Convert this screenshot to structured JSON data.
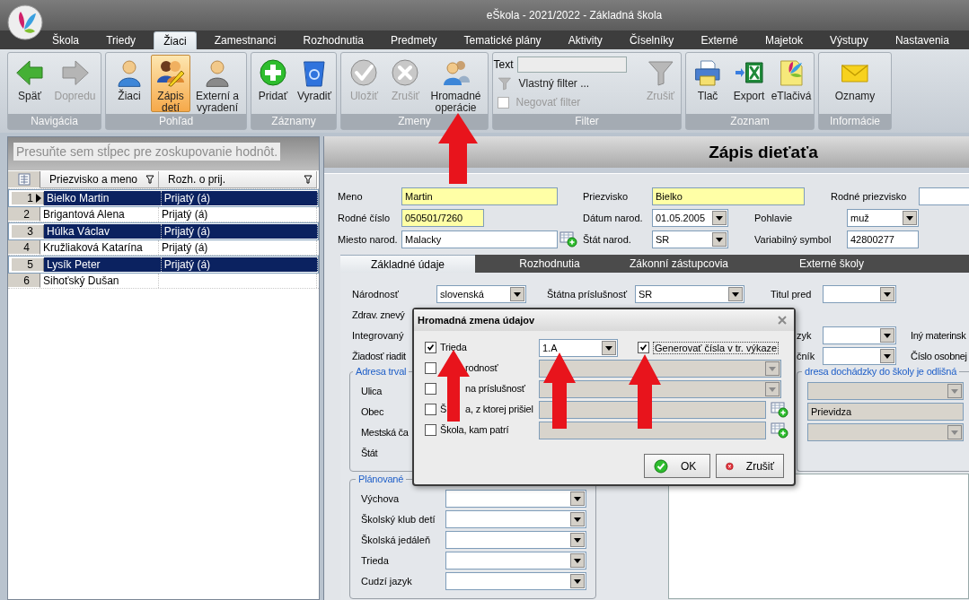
{
  "window": {
    "title": "eŠkola - 2021/2022 - Základná škola"
  },
  "menu_tabs": [
    {
      "label": "Škola",
      "selected": false
    },
    {
      "label": "Triedy",
      "selected": false
    },
    {
      "label": "Žiaci",
      "selected": true
    },
    {
      "label": "Zamestnanci",
      "selected": false
    },
    {
      "label": "Rozhodnutia",
      "selected": false
    },
    {
      "label": "Predmety",
      "selected": false
    },
    {
      "label": "Tematické plány",
      "selected": false
    },
    {
      "label": "Aktivity",
      "selected": false
    },
    {
      "label": "Číselníky",
      "selected": false
    },
    {
      "label": "Externé",
      "selected": false
    },
    {
      "label": "Majetok",
      "selected": false
    },
    {
      "label": "Výstupy",
      "selected": false
    },
    {
      "label": "Nastavenia",
      "selected": false
    }
  ],
  "ribbon_groups": [
    {
      "label": "Navigácia",
      "kind": "buttons",
      "buttons": [
        {
          "label": "Späť",
          "kind": "back",
          "disabled": false,
          "selected": false
        },
        {
          "label": "Dopredu",
          "kind": "forward",
          "disabled": true,
          "selected": false
        }
      ]
    },
    {
      "label": "Pohľad",
      "kind": "buttons",
      "buttons": [
        {
          "label": "Žiaci",
          "kind": "person",
          "disabled": false,
          "selected": false
        },
        {
          "label": "Zápis\ndetí",
          "kind": "enroll",
          "disabled": false,
          "selected": true
        },
        {
          "label": "Externí a\nvyradení",
          "kind": "person_gray",
          "disabled": false,
          "selected": false
        }
      ]
    },
    {
      "label": "Záznamy",
      "kind": "buttons",
      "buttons": [
        {
          "label": "Pridať",
          "kind": "add",
          "disabled": false,
          "selected": false
        },
        {
          "label": "Vyradiť",
          "kind": "delete",
          "disabled": false,
          "selected": false
        }
      ]
    },
    {
      "label": "Zmeny",
      "kind": "buttons",
      "buttons": [
        {
          "label": "Uložiť",
          "kind": "save",
          "disabled": true,
          "selected": false
        },
        {
          "label": "Zrušiť",
          "kind": "cancel",
          "disabled": true,
          "selected": false
        },
        {
          "label": "Hromadné\noperácie",
          "kind": "bulk",
          "disabled": false,
          "selected": false
        }
      ]
    },
    {
      "label": "Filter",
      "kind": "filter",
      "text_label": "Text",
      "custom_filter": "Vlastný filter ...",
      "negate": {
        "label": "Negovať filter",
        "checked": false,
        "disabled": true
      },
      "buttons": [
        {
          "label": "Zrušiť",
          "kind": "clear_filter",
          "disabled": true,
          "selected": false
        }
      ]
    },
    {
      "label": "Zoznam",
      "kind": "buttons",
      "buttons": [
        {
          "label": "Tlač",
          "kind": "print",
          "disabled": false,
          "selected": false
        },
        {
          "label": "Export",
          "kind": "export",
          "disabled": false,
          "selected": false
        },
        {
          "label": "eTlačivá",
          "kind": "forms",
          "disabled": false,
          "selected": false
        }
      ]
    },
    {
      "label": "Informácie",
      "kind": "buttons",
      "buttons": [
        {
          "label": "Oznamy",
          "kind": "notices",
          "disabled": false,
          "selected": false
        }
      ]
    }
  ],
  "grid": {
    "group_hint": "Presuňte sem stĺpec pre zoskupovanie hodnôt.",
    "columns": [
      {
        "label": "Priezvisko a meno"
      },
      {
        "label": "Rozh. o prij."
      }
    ],
    "rows": [
      {
        "number": "1",
        "name": "Bielko Martin",
        "decision": "Prijatý (á)",
        "selected": true,
        "current": true
      },
      {
        "number": "2",
        "name": "Brigantová Alena",
        "decision": "Prijatý (á)",
        "selected": false,
        "current": false
      },
      {
        "number": "3",
        "name": "Húlka Václav",
        "decision": "Prijatý (á)",
        "selected": true,
        "current": false
      },
      {
        "number": "4",
        "name": "Kružliaková Katarína",
        "decision": "Prijatý (á)",
        "selected": false,
        "current": false
      },
      {
        "number": "5",
        "name": "Lysík Peter",
        "decision": "Prijatý (á)",
        "selected": true,
        "current": false
      },
      {
        "number": "6",
        "name": "Sihoťský Dušan",
        "selected": false,
        "current": false
      }
    ]
  },
  "form": {
    "title": "Zápis dieťaťa",
    "meno": {
      "label": "Meno",
      "value": "Martin",
      "required": true
    },
    "priezvisko": {
      "label": "Priezvisko",
      "value": "Bielko",
      "required": true
    },
    "rodne_priezvisko": {
      "label": "Rodné priezvisko",
      "required": false
    },
    "rodne_cislo": {
      "label": "Rodné číslo",
      "value": "050501/7260",
      "required": true
    },
    "datum_narod": {
      "label": "Dátum narod.",
      "value": "01.05.2005"
    },
    "pohlavie": {
      "label": "Pohlavie",
      "value": "muž"
    },
    "miesto_narod": {
      "label": "Miesto narod.",
      "value": "Malacky",
      "required": false
    },
    "stat_narod": {
      "label": "Štát narod.",
      "value": "SR"
    },
    "variabilny_symbol": {
      "label": "Variabilný symbol",
      "value": "42800277",
      "required": false
    }
  },
  "detail_tabs": [
    {
      "label": "Základné údaje",
      "selected": true
    },
    {
      "label": "Rozhodnutia",
      "selected": false
    },
    {
      "label": "Zákonní zástupcovia",
      "selected": false
    },
    {
      "label": "Externé školy",
      "selected": false
    }
  ],
  "basic": {
    "narodnost": {
      "label": "Národnosť",
      "value": "slovenská"
    },
    "statna_prislusnost": {
      "label": "Štátna príslušnosť",
      "value": "SR"
    },
    "titul_pred": {
      "label": "Titul pred"
    },
    "zdrav": "Zdrav. znevý",
    "integrovany": "Integrovaný",
    "jazyk_label": "zyk",
    "iny_materinsky": "Iný materinsk",
    "ziadost": "Žiadosť riadit",
    "cnik_label": "čník",
    "cislo_osobnej": "Číslo osobnej",
    "address": {
      "title": "Adresa trval",
      "labels": [
        "Ulica",
        "Obec",
        "Mestská ča",
        "Štát"
      ]
    },
    "alt_address": {
      "title": "dresa dochádzky do školy je odlišná",
      "obec": "Prievidza"
    },
    "planned": {
      "title": "Plánované",
      "labels": [
        "Výchova",
        "Školský klub detí",
        "Školská jedáleň",
        "Trieda",
        "Cudzí jazyk"
      ]
    }
  },
  "dialog": {
    "title": "Hromadná zmena údajov",
    "rows": [
      {
        "label": "Trieda",
        "checked": true,
        "kind": "select",
        "value": "1.A",
        "extra": {
          "label": "Generovať čísla v tr. výkaze",
          "checked": true
        }
      },
      {
        "label_parts": {
          "after_arrow": "rodnosť"
        },
        "checked": false,
        "kind": "select"
      },
      {
        "label_parts": {
          "after_arrow": "na príslušnosť"
        },
        "checked": false,
        "kind": "select"
      },
      {
        "label_parts": {
          "before_arrow": "Š",
          "after_arrow": "a, z ktorej prišiel"
        },
        "checked": false,
        "kind": "lookup"
      },
      {
        "label": "Škola, kam patrí",
        "checked": false,
        "kind": "lookup"
      }
    ],
    "buttons": [
      {
        "label": "OK",
        "kind": "ok"
      },
      {
        "label": "Zrušiť",
        "kind": "cancel"
      }
    ]
  }
}
